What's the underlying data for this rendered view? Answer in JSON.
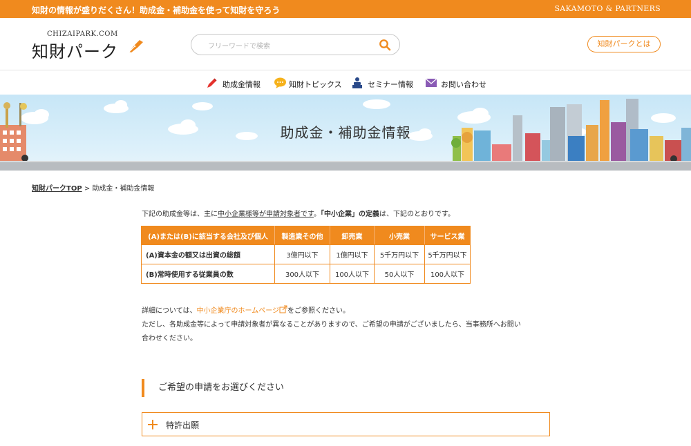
{
  "topbar": {
    "tagline": "知財の情報が盛りだくさん！助成金・補助金を使って知財を守ろう",
    "partners": "SAKAMOTO & PARTNERS"
  },
  "header": {
    "logo_sub": "CHIZAIPARK.COM",
    "logo_main": "知財パーク",
    "search_placeholder": "フリーワードで検索",
    "about_label": "知財パークとは"
  },
  "nav": [
    {
      "label": "助成金情報",
      "icon": "pen-icon"
    },
    {
      "label": "知財トピックス",
      "icon": "speech-bubble-icon"
    },
    {
      "label": "セミナー情報",
      "icon": "speaker-icon"
    },
    {
      "label": "お問い合わせ",
      "icon": "envelope-icon"
    }
  ],
  "banner": {
    "title": "助成金・補助金情報"
  },
  "breadcrumb": {
    "home": "知財パークTOP",
    "separator": " > ",
    "current": "助成金・補助金情報"
  },
  "intro": {
    "part1": "下記の助成金等は、主に",
    "underlined": "中小企業様等が申請対象者です",
    "part2": "。",
    "bold": "「中小企業」の定義",
    "part3": "は、下記のとおりです。"
  },
  "table": {
    "headers": [
      "(A)または(B)に該当する会社及び個人",
      "製造業その他",
      "卸売業",
      "小売業",
      "サービス業"
    ],
    "rows": [
      [
        "(A)資本金の額又は出資の総額",
        "3億円以下",
        "1億円以下",
        "5千万円以下",
        "5千万円以下"
      ],
      [
        "(B)常時使用する従業員の数",
        "300人以下",
        "100人以下",
        "50人以下",
        "100人以下"
      ]
    ]
  },
  "detail": {
    "line1_pre": "詳細については、",
    "link": "中小企業庁のホームページ",
    "line1_post": "をご参照ください。",
    "line2": "ただし、各助成金等によって申請対象者が異なることがありますので、ご希望の申請がございましたら、当事務所へお問い",
    "line3": "合わせください。"
  },
  "section": {
    "title": "ご希望の申請をお選びください"
  },
  "accordion": [
    {
      "label": "特許出願"
    }
  ],
  "colors": {
    "accent": "#f08a1e",
    "text": "#333333"
  }
}
